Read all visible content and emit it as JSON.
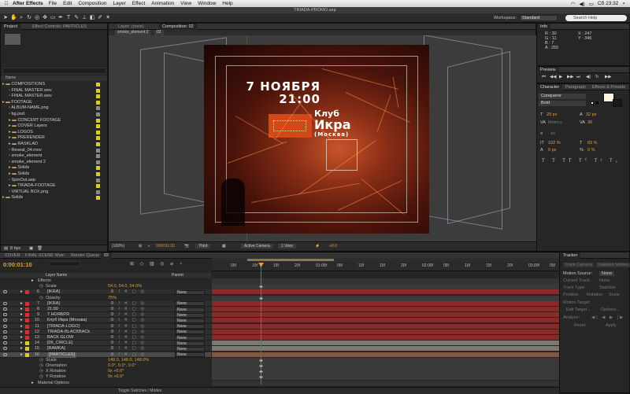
{
  "menubar": {
    "app_name": "After Effects",
    "items": [
      "File",
      "Edit",
      "Composition",
      "Layer",
      "Effect",
      "Animation",
      "View",
      "Window",
      "Help"
    ],
    "clock": "Сб 23:32"
  },
  "window": {
    "title": "TRIADA-PROMO.aep"
  },
  "toolbar": {
    "workspace_label": "Workspace:",
    "workspace_value": "Standard",
    "search_placeholder": "Search Help"
  },
  "project": {
    "tabs": [
      "Project",
      "Effect Controls: PARTICLES"
    ],
    "search_placeholder": "",
    "column_name": "Name",
    "items": [
      {
        "label": "COMPOSITIONS",
        "indent": 0,
        "type": "folder",
        "color": "#d9c83a"
      },
      {
        "label": "FINAL MASTER.wov",
        "indent": 1,
        "type": "comp",
        "color": "#d9c83a"
      },
      {
        "label": "FINAL MASTER.wov",
        "indent": 1,
        "type": "comp",
        "color": "#d9c83a"
      },
      {
        "label": "FOOTAGE",
        "indent": 0,
        "type": "folder",
        "color": "#d9c83a"
      },
      {
        "label": "ALBUM-NAME.png",
        "indent": 1,
        "type": "file",
        "color": "#8a8a8a"
      },
      {
        "label": "bg.psd",
        "indent": 1,
        "type": "file",
        "color": "#8a8a8a"
      },
      {
        "label": "CONCERT FOOTAGE",
        "indent": 1,
        "type": "folder",
        "color": "#d9c83a"
      },
      {
        "label": "COVER Layers",
        "indent": 1,
        "type": "folder",
        "color": "#d9c83a"
      },
      {
        "label": "LOGOS",
        "indent": 1,
        "type": "folder",
        "color": "#d9c83a"
      },
      {
        "label": "PRERENDER",
        "indent": 1,
        "type": "folder",
        "color": "#d9c83a"
      },
      {
        "label": "RASKLAD",
        "indent": 1,
        "type": "folder",
        "color": "#d9c83a"
      },
      {
        "label": "Reveal_04.mov",
        "indent": 1,
        "type": "file",
        "color": "#8a8a8a"
      },
      {
        "label": "smoke_element",
        "indent": 1,
        "type": "file",
        "color": "#8a8a8a"
      },
      {
        "label": "smoke_element 2",
        "indent": 1,
        "type": "file",
        "color": "#8a8a8a"
      },
      {
        "label": "Solids",
        "indent": 1,
        "type": "folder",
        "color": "#d9c83a"
      },
      {
        "label": "Solids",
        "indent": 1,
        "type": "folder",
        "color": "#d9c83a"
      },
      {
        "label": "SpinOut.aep",
        "indent": 1,
        "type": "file",
        "color": "#8a8a8a"
      },
      {
        "label": "TRIADA-FOOTAGE",
        "indent": 1,
        "type": "folder",
        "color": "#d9c83a"
      },
      {
        "label": "VIRTUAL BOX.png",
        "indent": 1,
        "type": "file",
        "color": "#8a8a8a"
      },
      {
        "label": "Solids",
        "indent": 0,
        "type": "folder",
        "color": "#d9c83a"
      }
    ],
    "footer_bpc": "8 bpc"
  },
  "composition": {
    "tabs": [
      "Layer: (none)",
      "Composition: 02"
    ],
    "breadcrumbs": [
      "smoke_element 2",
      "02"
    ],
    "artwork": {
      "date_line1": "7 НОЯБРЯ",
      "date_line2": "21:00",
      "club_line1": "Клуб",
      "club_line2": "Икра",
      "club_line3": "(Москва)"
    },
    "footer": {
      "zoom": "(100%)",
      "timecode": "0:00:01:10",
      "resolution": "Third",
      "camera": "Active Camera",
      "views": "1 View",
      "exposure": "+0.0"
    }
  },
  "info": {
    "tab": "Info",
    "r": "R : 30",
    "g": "G : 11",
    "b": "B : 7",
    "a": "A : 255",
    "x": "X : 247",
    "y": "Y : 346"
  },
  "preview": {
    "tab": "Preview"
  },
  "character": {
    "tabs": [
      "Character",
      "Paragraph",
      "Effects & Presets"
    ],
    "font": "Conqueror",
    "style": "Bold",
    "size": "29 px",
    "leading": "32 px",
    "kerning": "Metrics",
    "tracking": "30",
    "stroke": "- px",
    "vscale": "102 %",
    "hscale": "83 %",
    "baseline": "0 px",
    "tsume": "0 %"
  },
  "timeline": {
    "tabs": [
      "COVER",
      "FINAL SCENE",
      "Main",
      "Render Queue",
      "02"
    ],
    "timecode": "0:00:01:10",
    "column_name": "Layer Name",
    "column_mode": "Parent",
    "ruler": [
      "05f",
      "10f",
      "15f",
      "20f",
      "01:00f",
      "05f",
      "10f",
      "15f",
      "20f",
      "02:00f",
      "05f",
      "10f",
      "15f",
      "20f",
      "03:00f",
      "05f"
    ],
    "footer": "Toggle Switches / Modes",
    "rows": [
      {
        "kind": "effects",
        "label": "Effects"
      },
      {
        "kind": "prop",
        "label": "Scale",
        "value": "54.0, 54.0, 54.0%"
      },
      {
        "kind": "layer",
        "num": "6",
        "name": "[IKRA]",
        "color": "#c33",
        "mode": "None"
      },
      {
        "kind": "prop",
        "label": "Opacity",
        "value": "75%"
      },
      {
        "kind": "layer",
        "num": "7",
        "name": "[IKRA]",
        "color": "#c33",
        "mode": "None"
      },
      {
        "kind": "layer",
        "num": "8",
        "name": "21:00",
        "color": "#c33",
        "mode": "None"
      },
      {
        "kind": "layer",
        "num": "9",
        "name": "7 НОЯБРЯ",
        "color": "#c33",
        "mode": "None"
      },
      {
        "kind": "layer",
        "num": "10",
        "name": "Клуб Икра (Москва)",
        "color": "#c33",
        "mode": "None"
      },
      {
        "kind": "layer",
        "num": "11",
        "name": "[TRIADA-LOGO]",
        "color": "#c33",
        "mode": "None"
      },
      {
        "kind": "layer",
        "num": "12",
        "name": "TRIADA-BLACKBACk",
        "color": "#c33",
        "mode": "None"
      },
      {
        "kind": "layer",
        "num": "13",
        "name": "BACK GLOW",
        "color": "#c33",
        "mode": "None"
      },
      {
        "kind": "layer",
        "num": "14",
        "name": "[06_CIRCLE]",
        "color": "#d9c83a",
        "mode": "None"
      },
      {
        "kind": "layer",
        "num": "15",
        "name": "[RAMKA]",
        "color": "#d9c83a",
        "mode": "None"
      },
      {
        "kind": "layer",
        "num": "16",
        "name": "[PARTICLES]",
        "color": "#d9c83a",
        "mode": "None",
        "selected": true
      },
      {
        "kind": "prop",
        "label": "Scale",
        "value": "148.0, 148.0, 148.0%"
      },
      {
        "kind": "prop",
        "label": "Orientation",
        "value": "0.0°, 0.0°, 0.0°"
      },
      {
        "kind": "prop",
        "label": "X Rotation",
        "value": "0x +0.0°"
      },
      {
        "kind": "prop",
        "label": "Y Rotation",
        "value": "0x +0.0°"
      },
      {
        "kind": "group",
        "label": "Material Options"
      }
    ]
  },
  "tracker": {
    "tab": "Tracker",
    "track_camera": "Track Camera",
    "stabilize": "Stabilize Motion",
    "motion_source_label": "Motion Source:",
    "motion_source": "None",
    "current_track_label": "Current Track:",
    "current_track": "None",
    "track_type_label": "Track Type:",
    "track_type": "Stabilize",
    "position": "Position",
    "rotation": "Rotation",
    "scale": "Scale",
    "motion_target": "Motion Target:",
    "edit_target": "Edit Target...",
    "options": "Options...",
    "analyze": "Analyze:",
    "reset": "Reset",
    "apply": "Apply"
  }
}
